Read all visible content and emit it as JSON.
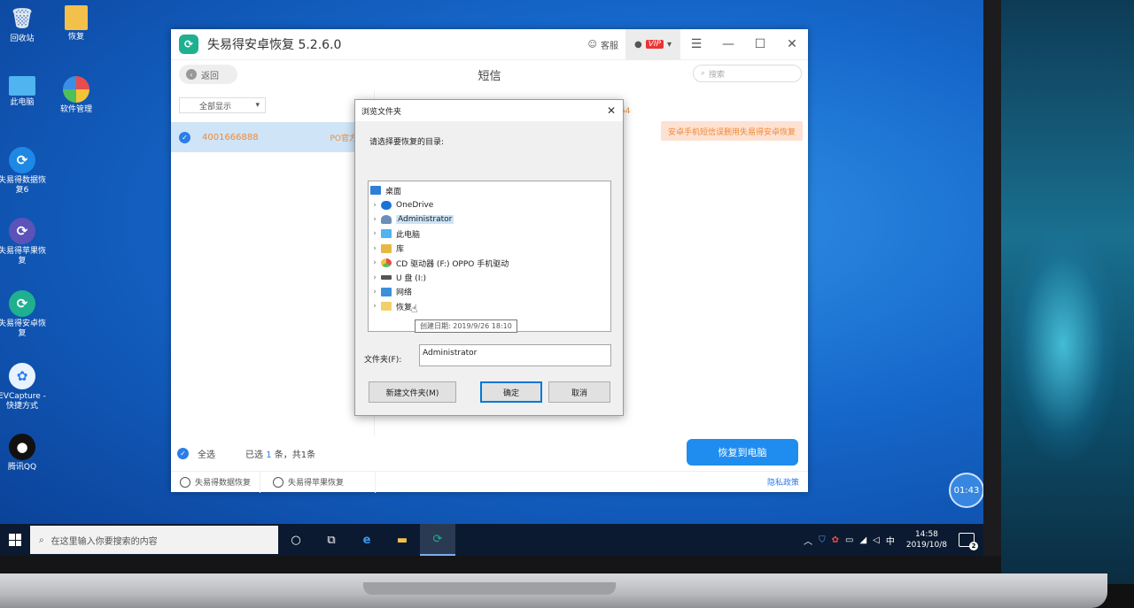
{
  "desktop": {
    "icons": [
      {
        "label": "回收站"
      },
      {
        "label": "恢复"
      },
      {
        "label": "此电脑"
      },
      {
        "label": "软件管理"
      },
      {
        "label": "失易得数据恢复6"
      },
      {
        "label": "失易得苹果恢复"
      },
      {
        "label": "失易得安卓恢复"
      },
      {
        "label": "EVCapture - 快捷方式"
      },
      {
        "label": "腾讯QQ"
      }
    ]
  },
  "app": {
    "title": "失易得安卓恢复  5.2.6.0",
    "service_label": "客服",
    "vip_label": "VIP",
    "back_label": "返回",
    "page_title": "短信",
    "search_placeholder": "搜索",
    "filter_label": "全部显示",
    "message": {
      "number": "4001666888",
      "preview": "PO官方",
      "date_fragment": "54",
      "bubble_text": "安卓手机短信误删用失易得安卓恢复"
    },
    "select_all_label": "全选",
    "selection_prefix": "已选 ",
    "selection_count": "1",
    "selection_suffix": " 条，共1条",
    "recover_button": "恢复到电脑",
    "footer_links": [
      "失易得数据恢复",
      "失易得苹果恢复"
    ],
    "privacy_link": "隐私政策"
  },
  "dialog": {
    "title": "浏览文件夹",
    "prompt": "请选择要恢复的目录:",
    "tree": [
      {
        "label": "桌面",
        "root": true
      },
      {
        "label": "OneDrive"
      },
      {
        "label": "Administrator",
        "selected": true
      },
      {
        "label": "此电脑"
      },
      {
        "label": "库"
      },
      {
        "label": "CD 驱动器 (F:) OPPO 手机驱动"
      },
      {
        "label": "U 盘 (I:)"
      },
      {
        "label": "网络"
      },
      {
        "label": "恢复"
      }
    ],
    "tooltip": "创建日期: 2019/9/26 18:10",
    "folder_label": "文件夹(F):",
    "folder_value": "Administrator",
    "new_folder_button": "新建文件夹(M)",
    "ok_button": "确定",
    "cancel_button": "取消"
  },
  "taskbar": {
    "search_placeholder": "在这里输入你要搜索的内容",
    "ime": "中",
    "time": "14:58",
    "date": "2019/10/8",
    "notification_count": "2"
  },
  "timer": "01:43"
}
